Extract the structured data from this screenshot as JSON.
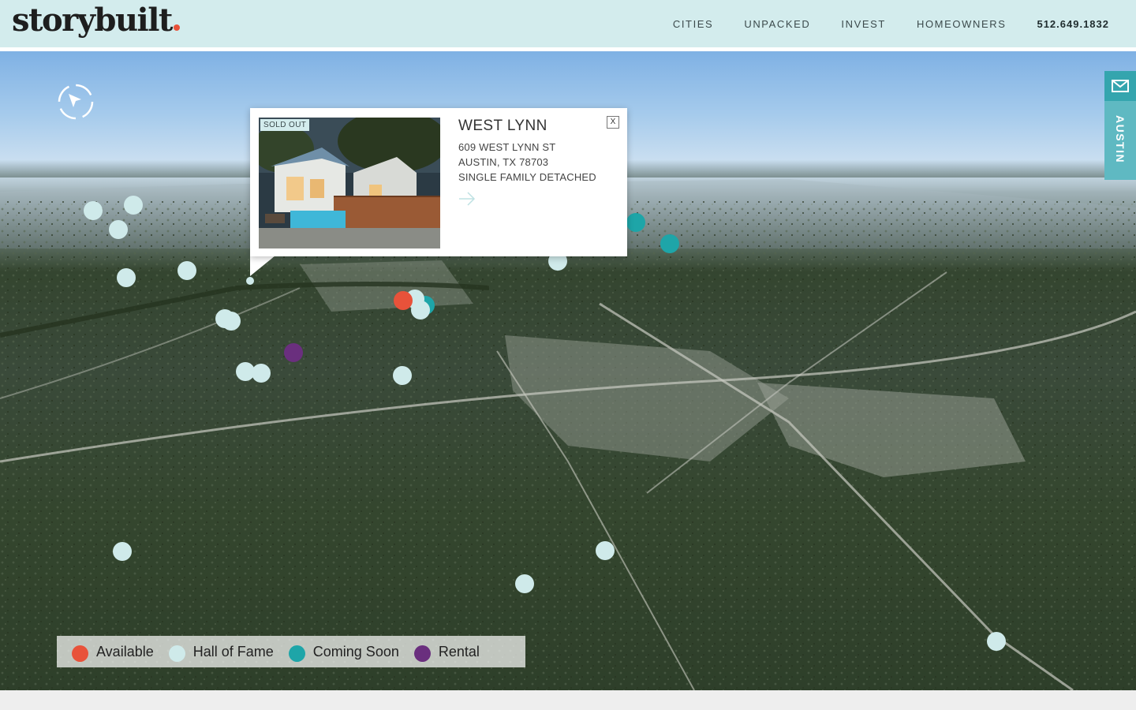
{
  "header": {
    "logo_text": "storybuilt",
    "logo_dot_color": "#e8523a",
    "nav": [
      "CITIES",
      "UNPACKED",
      "INVEST",
      "HOMEOWNERS"
    ],
    "phone": "512.649.1832"
  },
  "map": {
    "compass_icon": "compass-reset-icon",
    "side_tab": {
      "icon": "mail-icon",
      "city": "AUSTIN"
    }
  },
  "popup": {
    "badge": "SOLD OUT",
    "title": "WEST LYNN",
    "address_line1": "609 WEST LYNN ST",
    "address_line2": "AUSTIN, TX 78703",
    "type": "SINGLE FAMILY DETACHED",
    "close_label": "X",
    "arrow_icon": "arrow-right-icon"
  },
  "legend": [
    {
      "label": "Available",
      "color": "#e8523a"
    },
    {
      "label": "Hall of Fame",
      "color": "#cfeaea"
    },
    {
      "label": "Coming Soon",
      "color": "#1ea5a8"
    },
    {
      "label": "Rental",
      "color": "#6a2f7e"
    }
  ]
}
